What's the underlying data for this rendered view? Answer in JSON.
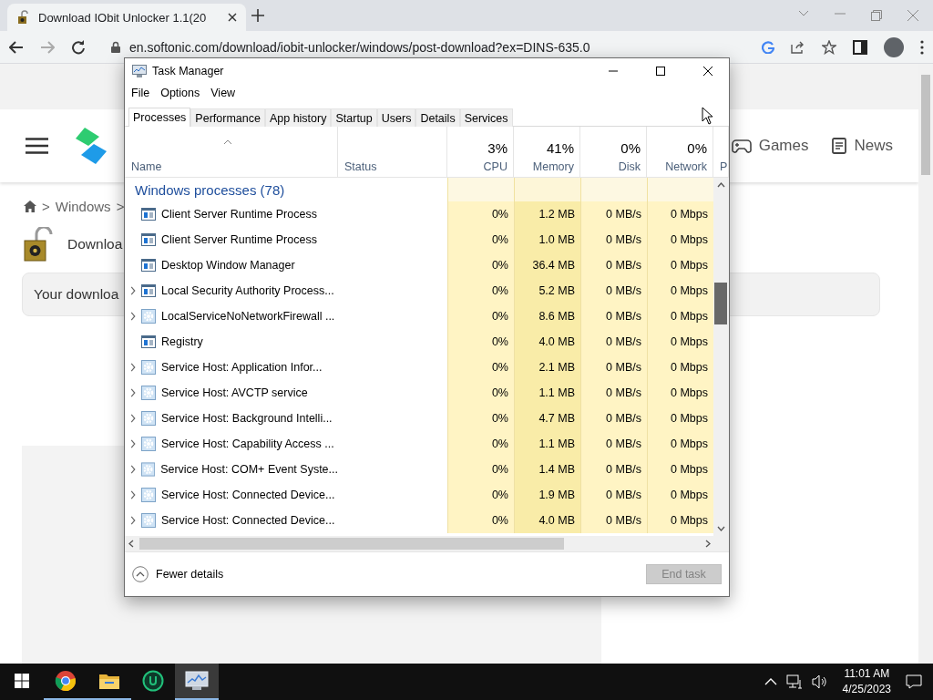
{
  "browser": {
    "tab_title": "Download IObit Unlocker 1.1(20",
    "url": "en.softonic.com/download/iobit-unlocker/windows/post-download?ex=DINS-635.0"
  },
  "page": {
    "nav": [
      "Games",
      "News"
    ],
    "breadcrumb": [
      ">",
      "Windows",
      ">"
    ],
    "title": "Downloa",
    "notice": "Your downloa"
  },
  "task_manager": {
    "title": "Task Manager",
    "menu": [
      "File",
      "Options",
      "View"
    ],
    "tabs": [
      {
        "label": "Processes",
        "selected": true
      },
      {
        "label": "Performance",
        "selected": false
      },
      {
        "label": "App history",
        "selected": false
      },
      {
        "label": "Startup",
        "selected": false
      },
      {
        "label": "Users",
        "selected": false
      },
      {
        "label": "Details",
        "selected": false
      },
      {
        "label": "Services",
        "selected": false
      }
    ],
    "columns": [
      {
        "label": "Name"
      },
      {
        "label": "Status"
      },
      {
        "label": "CPU",
        "percent": "3%"
      },
      {
        "label": "Memory",
        "percent": "41%"
      },
      {
        "label": "Disk",
        "percent": "0%"
      },
      {
        "label": "Network",
        "percent": "0%"
      },
      {
        "label": "P"
      }
    ],
    "group": "Windows processes (78)",
    "rows": [
      {
        "name": "Client Server Runtime Process",
        "kind": "window",
        "expandable": false,
        "cpu": "0%",
        "memory": "1.2 MB",
        "disk": "0 MB/s",
        "network": "0 Mbps"
      },
      {
        "name": "Client Server Runtime Process",
        "kind": "window",
        "expandable": false,
        "cpu": "0%",
        "memory": "1.0 MB",
        "disk": "0 MB/s",
        "network": "0 Mbps"
      },
      {
        "name": "Desktop Window Manager",
        "kind": "window",
        "expandable": false,
        "cpu": "0%",
        "memory": "36.4 MB",
        "disk": "0 MB/s",
        "network": "0 Mbps"
      },
      {
        "name": "Local Security Authority Process...",
        "kind": "window",
        "expandable": true,
        "cpu": "0%",
        "memory": "5.2 MB",
        "disk": "0 MB/s",
        "network": "0 Mbps"
      },
      {
        "name": "LocalServiceNoNetworkFirewall ...",
        "kind": "gear",
        "expandable": true,
        "cpu": "0%",
        "memory": "8.6 MB",
        "disk": "0 MB/s",
        "network": "0 Mbps"
      },
      {
        "name": "Registry",
        "kind": "window",
        "expandable": false,
        "cpu": "0%",
        "memory": "4.0 MB",
        "disk": "0 MB/s",
        "network": "0 Mbps"
      },
      {
        "name": "Service Host: Application Infor...",
        "kind": "gear",
        "expandable": true,
        "cpu": "0%",
        "memory": "2.1 MB",
        "disk": "0 MB/s",
        "network": "0 Mbps"
      },
      {
        "name": "Service Host: AVCTP service",
        "kind": "gear",
        "expandable": true,
        "cpu": "0%",
        "memory": "1.1 MB",
        "disk": "0 MB/s",
        "network": "0 Mbps"
      },
      {
        "name": "Service Host: Background Intelli...",
        "kind": "gear",
        "expandable": true,
        "cpu": "0%",
        "memory": "4.7 MB",
        "disk": "0 MB/s",
        "network": "0 Mbps"
      },
      {
        "name": "Service Host: Capability Access ...",
        "kind": "gear",
        "expandable": true,
        "cpu": "0%",
        "memory": "1.1 MB",
        "disk": "0 MB/s",
        "network": "0 Mbps"
      },
      {
        "name": "Service Host: COM+ Event Syste...",
        "kind": "gear",
        "expandable": true,
        "cpu": "0%",
        "memory": "1.4 MB",
        "disk": "0 MB/s",
        "network": "0 Mbps"
      },
      {
        "name": "Service Host: Connected Device...",
        "kind": "gear",
        "expandable": true,
        "cpu": "0%",
        "memory": "1.9 MB",
        "disk": "0 MB/s",
        "network": "0 Mbps"
      },
      {
        "name": "Service Host: Connected Device...",
        "kind": "gear",
        "expandable": true,
        "cpu": "0%",
        "memory": "4.0 MB",
        "disk": "0 MB/s",
        "network": "0 Mbps"
      }
    ],
    "footer": {
      "toggle": "Fewer details",
      "end_task": {
        "label": "End task",
        "disabled": true
      }
    }
  },
  "taskbar": {
    "apps": [
      {
        "kind": "chrome",
        "running": true,
        "active": false
      },
      {
        "kind": "folder",
        "running": true,
        "active": false
      },
      {
        "kind": "unlocker",
        "running": false,
        "active": false
      },
      {
        "kind": "taskmgr",
        "running": true,
        "active": true
      }
    ],
    "time": "11:01 AM",
    "date": "4/25/2023"
  }
}
